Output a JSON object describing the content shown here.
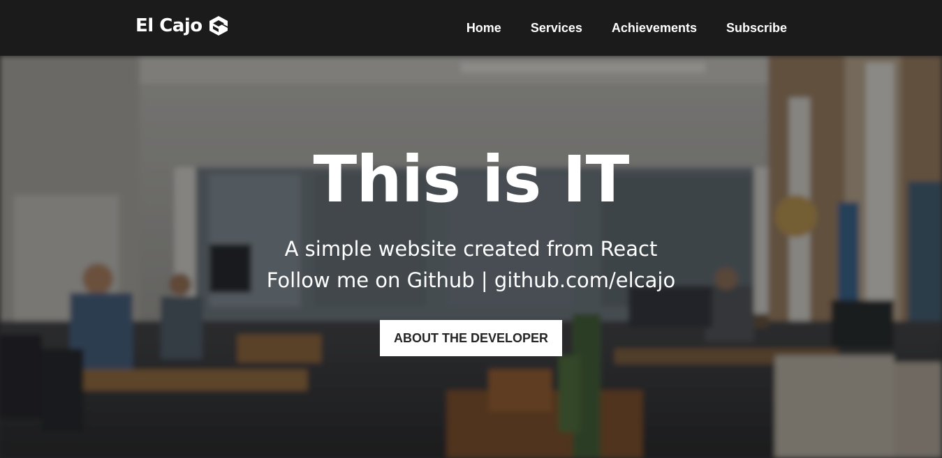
{
  "navbar": {
    "brand_text": "El Cajo",
    "brand_icon": "cube-logo-icon",
    "links": [
      {
        "label": "Home"
      },
      {
        "label": "Services"
      },
      {
        "label": "Achievements"
      },
      {
        "label": "Subscribe"
      }
    ]
  },
  "hero": {
    "title": "This is IT",
    "subtitle_line1": "A simple website created from React",
    "subtitle_line2": "Follow me on Github | github.com/elcajo",
    "button_label": "ABOUT THE DEVELOPER",
    "background": "blurred office photo"
  },
  "colors": {
    "navbar_bg": "#1b1b1b",
    "text": "#ffffff",
    "button_bg": "#ffffff",
    "button_text": "#242424"
  }
}
